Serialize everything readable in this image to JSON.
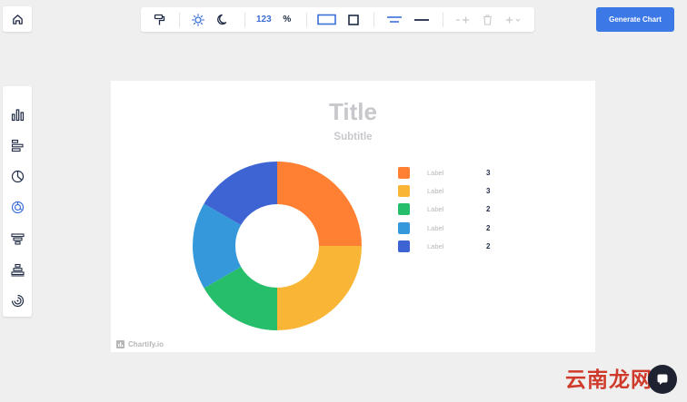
{
  "toolbar": {
    "number_format": "123",
    "percent_format": "%"
  },
  "generate_button": "Generate Chart",
  "sidebar": {
    "items": [
      {
        "icon": "bar-chart-icon"
      },
      {
        "icon": "horizontal-bar-chart-icon"
      },
      {
        "icon": "pie-chart-icon"
      },
      {
        "icon": "donut-chart-icon",
        "active": true
      },
      {
        "icon": "funnel-chart-icon"
      },
      {
        "icon": "pyramid-chart-icon"
      },
      {
        "icon": "radial-chart-icon"
      }
    ]
  },
  "canvas": {
    "title": "Title",
    "subtitle": "Subtitle",
    "watermark": "Chartify.io"
  },
  "chart_data": {
    "type": "pie",
    "variant": "donut",
    "title": "Title",
    "subtitle": "Subtitle",
    "categories": [
      "Label",
      "Label",
      "Label",
      "Label",
      "Label"
    ],
    "values": [
      3,
      3,
      2,
      2,
      2
    ],
    "colors": [
      "#ff7f33",
      "#f9b636",
      "#27be6b",
      "#3498db",
      "#3d64d2"
    ],
    "legend": "right"
  },
  "corner_watermark": "云南龙网"
}
